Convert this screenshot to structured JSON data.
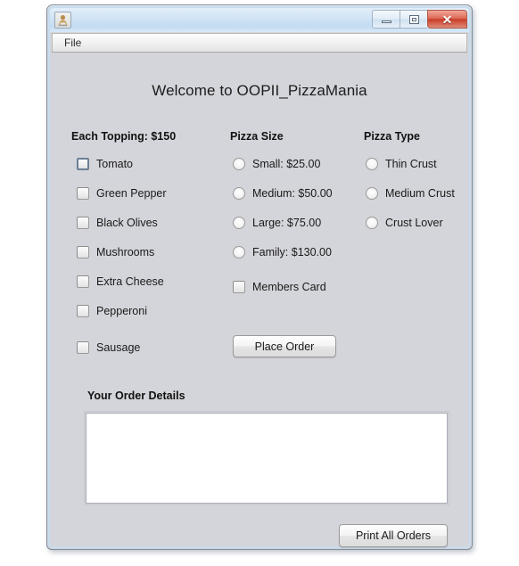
{
  "window": {
    "app_icon": "java-duke-icon",
    "buttons": {
      "minimize": "minimize-icon",
      "maximize": "maximize-icon",
      "close": "✕"
    }
  },
  "menubar": {
    "items": [
      {
        "label": "File"
      }
    ]
  },
  "main": {
    "title": "Welcome to OOPII_PizzaMania",
    "columns": {
      "toppings_header": "Each Topping: $150",
      "size_header": "Pizza Size",
      "type_header": "Pizza Type"
    },
    "toppings": [
      {
        "label": "Tomato",
        "checked": false,
        "focused": true
      },
      {
        "label": "Green Pepper",
        "checked": false,
        "focused": false
      },
      {
        "label": "Black Olives",
        "checked": false,
        "focused": false
      },
      {
        "label": "Mushrooms",
        "checked": false,
        "focused": false
      },
      {
        "label": "Extra Cheese",
        "checked": false,
        "focused": false
      },
      {
        "label": "Pepperoni",
        "checked": false,
        "focused": false
      },
      {
        "label": "Sausage",
        "checked": false,
        "focused": false
      }
    ],
    "sizes": [
      {
        "label": "Small: $25.00",
        "selected": false
      },
      {
        "label": "Medium: $50.00",
        "selected": false
      },
      {
        "label": "Large: $75.00",
        "selected": false
      },
      {
        "label": "Family: $130.00",
        "selected": false
      }
    ],
    "members_card": {
      "label": "Members Card",
      "checked": false
    },
    "types": [
      {
        "label": "Thin Crust",
        "selected": false
      },
      {
        "label": "Medium Crust",
        "selected": false
      },
      {
        "label": "Crust Lover",
        "selected": false
      }
    ],
    "place_order_label": "Place Order",
    "order_details_label": "Your Order Details",
    "order_details_value": "",
    "print_all_orders_label": "Print All Orders"
  },
  "colors": {
    "panel_bg": "#d4d5da",
    "titlebar_blue": "#cfe3f5",
    "close_red": "#c93d28",
    "textarea_bg": "#ffffff",
    "focus_border": "#6b7f96"
  }
}
